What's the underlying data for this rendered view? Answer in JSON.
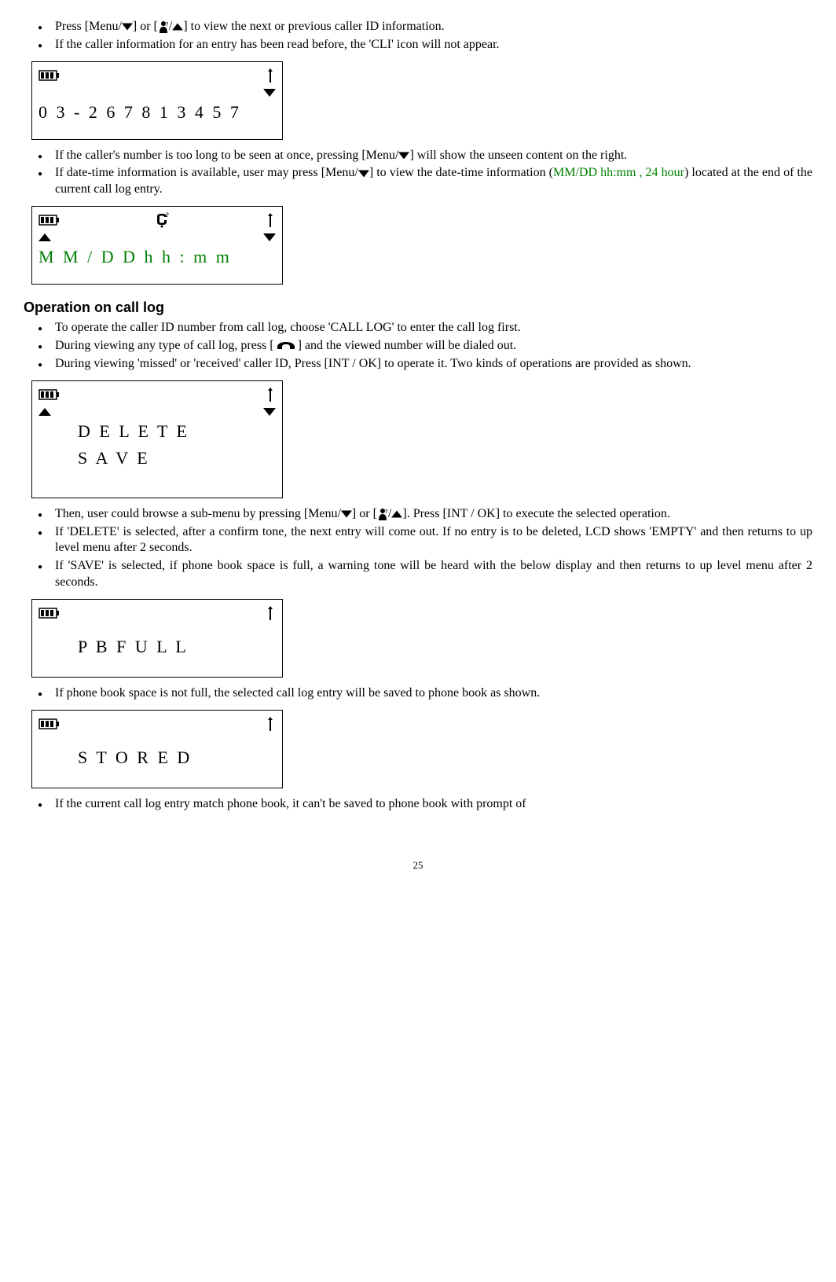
{
  "intro": {
    "b1_a": "Press [Menu/",
    "b1_b": "] or [",
    "b1_c": "/",
    "b1_d": "] to view the next or previous caller ID information.",
    "b2": "If the caller information for an entry has been read before, the 'CLI' icon will not appear."
  },
  "lcd1": {
    "line": "0 3 - 2 6 7 8 1 3 4 5 7"
  },
  "after_lcd1": {
    "b1_a": "If the caller's number is too long to be seen at once, pressing [Menu/",
    "b1_b": "]  will show the unseen content on the right.",
    "b2_a": "If date-time information is available, user may press [Menu/",
    "b2_b": "] to view the date-time information (",
    "b2_green": "MM/DD   hh:mm   , 24 hour",
    "b2_c": ") located at the end of the current call log entry."
  },
  "lcd2": {
    "line": "M M / D D    h h  :  m m"
  },
  "section_title": "Operation on call log",
  "op": {
    "b1": "To operate the caller ID number from call log, choose 'CALL LOG' to enter the call log first.",
    "b2_a": "During viewing any type of call log, press [",
    "b2_b": "] and the viewed number will be dialed out.",
    "b3": "During viewing 'missed' or 'received' caller ID, Press [INT / OK] to operate it. Two kinds of operations are provided as shown."
  },
  "lcd3": {
    "line1": "D E L E T E",
    "line2": "S A V E"
  },
  "after_lcd3": {
    "b1_a": "Then, user could browse a sub-menu by pressing [Menu/",
    "b1_b": "] or [",
    "b1_c": "/",
    "b1_d": "]. Press [INT / OK] to execute the selected operation.",
    "b2": "If 'DELETE' is selected, after a confirm tone, the next entry will come out. If no entry is to be deleted, LCD shows 'EMPTY' and then returns to up level menu after 2 seconds.",
    "b3": "If 'SAVE' is selected, if phone book space is full, a warning tone will be heard with the below display and then returns to up level menu after 2 seconds."
  },
  "lcd4": {
    "line": "P B    F U L L"
  },
  "after_lcd4": {
    "b1": "If phone book space is not full, the selected call log entry will be saved to phone book as shown."
  },
  "lcd5": {
    "line": "S T O R E D"
  },
  "after_lcd5": {
    "b1": "If the current call log entry match phone book, it can't be saved to phone book with prompt of"
  },
  "page_number": "25"
}
